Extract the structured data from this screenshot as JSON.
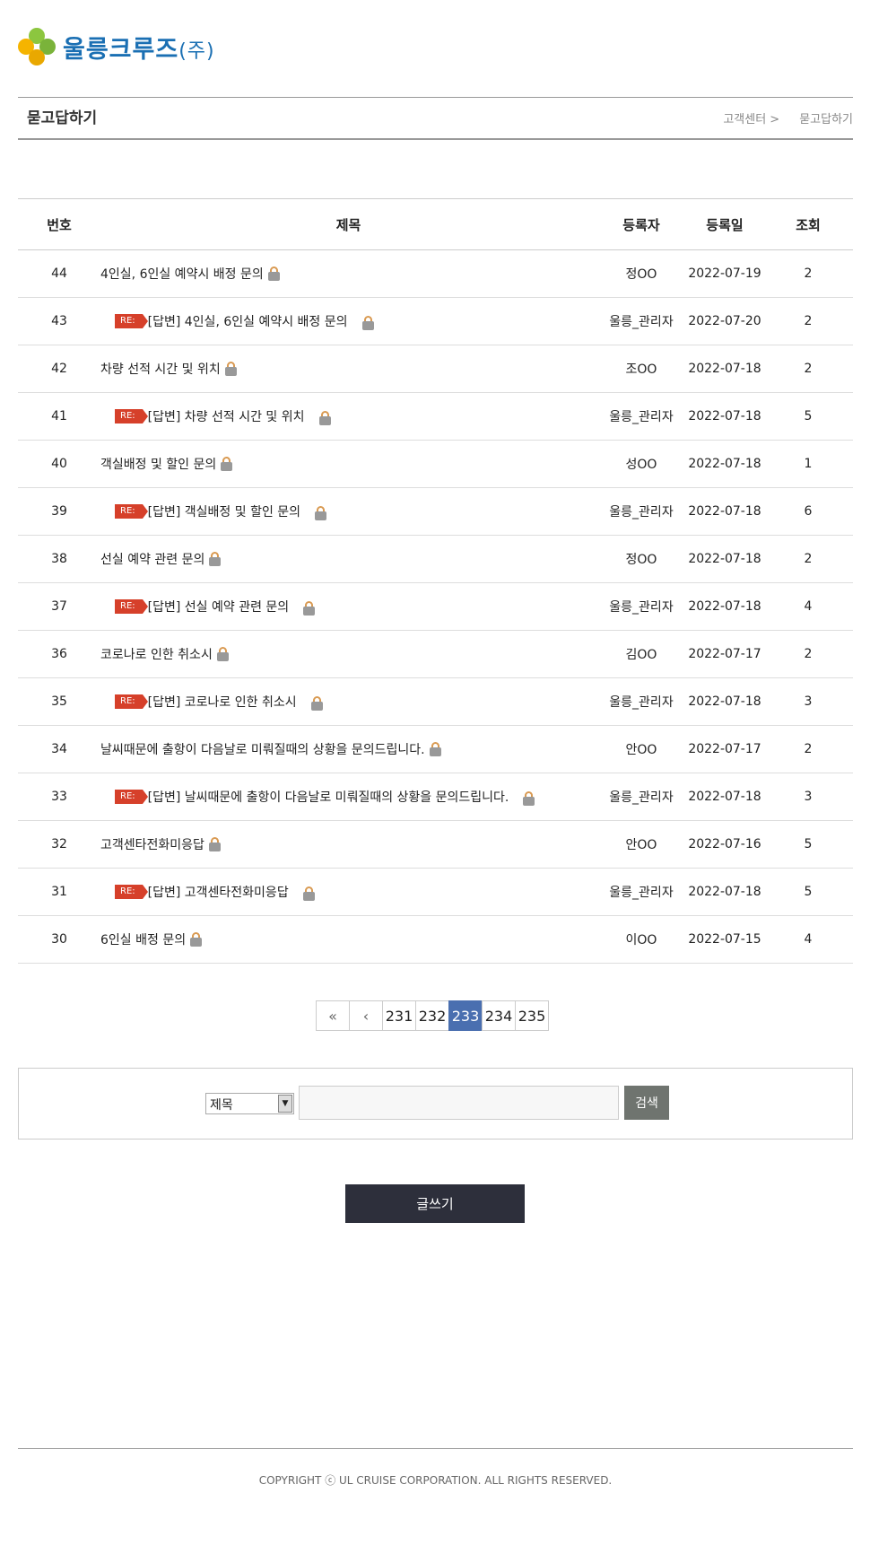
{
  "brand": {
    "name": "울릉크루즈",
    "suffix": "(주)"
  },
  "titlebar": {
    "title": "묻고답하기",
    "breadcrumb": [
      "고객센터 >",
      "묻고답하기"
    ]
  },
  "table": {
    "headers": [
      "번호",
      "제목",
      "등록자",
      "등록일",
      "조회"
    ],
    "rows": [
      {
        "no": "44",
        "reply": false,
        "title": "4인실, 6인실 예약시 배정 문의",
        "author": "정OO",
        "date": "2022-07-19",
        "views": "2"
      },
      {
        "no": "43",
        "reply": true,
        "title": "[답변] 4인실, 6인실 예약시 배정 문의",
        "author": "울릉_관리자",
        "date": "2022-07-20",
        "views": "2"
      },
      {
        "no": "42",
        "reply": false,
        "title": "차량 선적 시간 및 위치",
        "author": "조OO",
        "date": "2022-07-18",
        "views": "2"
      },
      {
        "no": "41",
        "reply": true,
        "title": "[답변] 차량 선적 시간 및 위치",
        "author": "울릉_관리자",
        "date": "2022-07-18",
        "views": "5"
      },
      {
        "no": "40",
        "reply": false,
        "title": "객실배정 및 할인 문의",
        "author": "성OO",
        "date": "2022-07-18",
        "views": "1"
      },
      {
        "no": "39",
        "reply": true,
        "title": "[답변] 객실배정 및 할인 문의",
        "author": "울릉_관리자",
        "date": "2022-07-18",
        "views": "6"
      },
      {
        "no": "38",
        "reply": false,
        "title": "선실 예약 관련 문의",
        "author": "정OO",
        "date": "2022-07-18",
        "views": "2"
      },
      {
        "no": "37",
        "reply": true,
        "title": "[답변] 선실 예약 관련 문의",
        "author": "울릉_관리자",
        "date": "2022-07-18",
        "views": "4"
      },
      {
        "no": "36",
        "reply": false,
        "title": "코로나로 인한 취소시",
        "author": "김OO",
        "date": "2022-07-17",
        "views": "2"
      },
      {
        "no": "35",
        "reply": true,
        "title": "[답변] 코로나로 인한 취소시",
        "author": "울릉_관리자",
        "date": "2022-07-18",
        "views": "3"
      },
      {
        "no": "34",
        "reply": false,
        "title": "날씨때문에 출항이 다음날로 미뤄질때의 상황을 문의드립니다.",
        "author": "안OO",
        "date": "2022-07-17",
        "views": "2"
      },
      {
        "no": "33",
        "reply": true,
        "title": "[답변] 날씨때문에 출항이 다음날로 미뤄질때의 상황을 문의드립니다.",
        "author": "울릉_관리자",
        "date": "2022-07-18",
        "views": "3"
      },
      {
        "no": "32",
        "reply": false,
        "title": "고객센타전화미응답",
        "author": "안OO",
        "date": "2022-07-16",
        "views": "5"
      },
      {
        "no": "31",
        "reply": true,
        "title": "[답변] 고객센타전화미응답",
        "author": "울릉_관리자",
        "date": "2022-07-18",
        "views": "5"
      },
      {
        "no": "30",
        "reply": false,
        "title": "6인실 배정 문의",
        "author": "이OO",
        "date": "2022-07-15",
        "views": "4"
      }
    ],
    "re_label": "RE:"
  },
  "pagination": {
    "first": "«",
    "prev": "‹",
    "pages": [
      "231",
      "232",
      "233",
      "234",
      "235"
    ],
    "current": "233"
  },
  "search": {
    "select_value": "제목",
    "input_value": "",
    "button": "검색"
  },
  "write_button": "글쓰기",
  "footer": "COPYRIGHT ⓒ UL CRUISE CORPORATION. ALL RIGHTS RESERVED.",
  "colors": {
    "brand": "#1a6fb3",
    "re_badge": "#d6402a",
    "page_active": "#4a6fb0",
    "write_btn": "#2d2f3b"
  },
  "icons": {
    "lock": "lock-icon"
  }
}
